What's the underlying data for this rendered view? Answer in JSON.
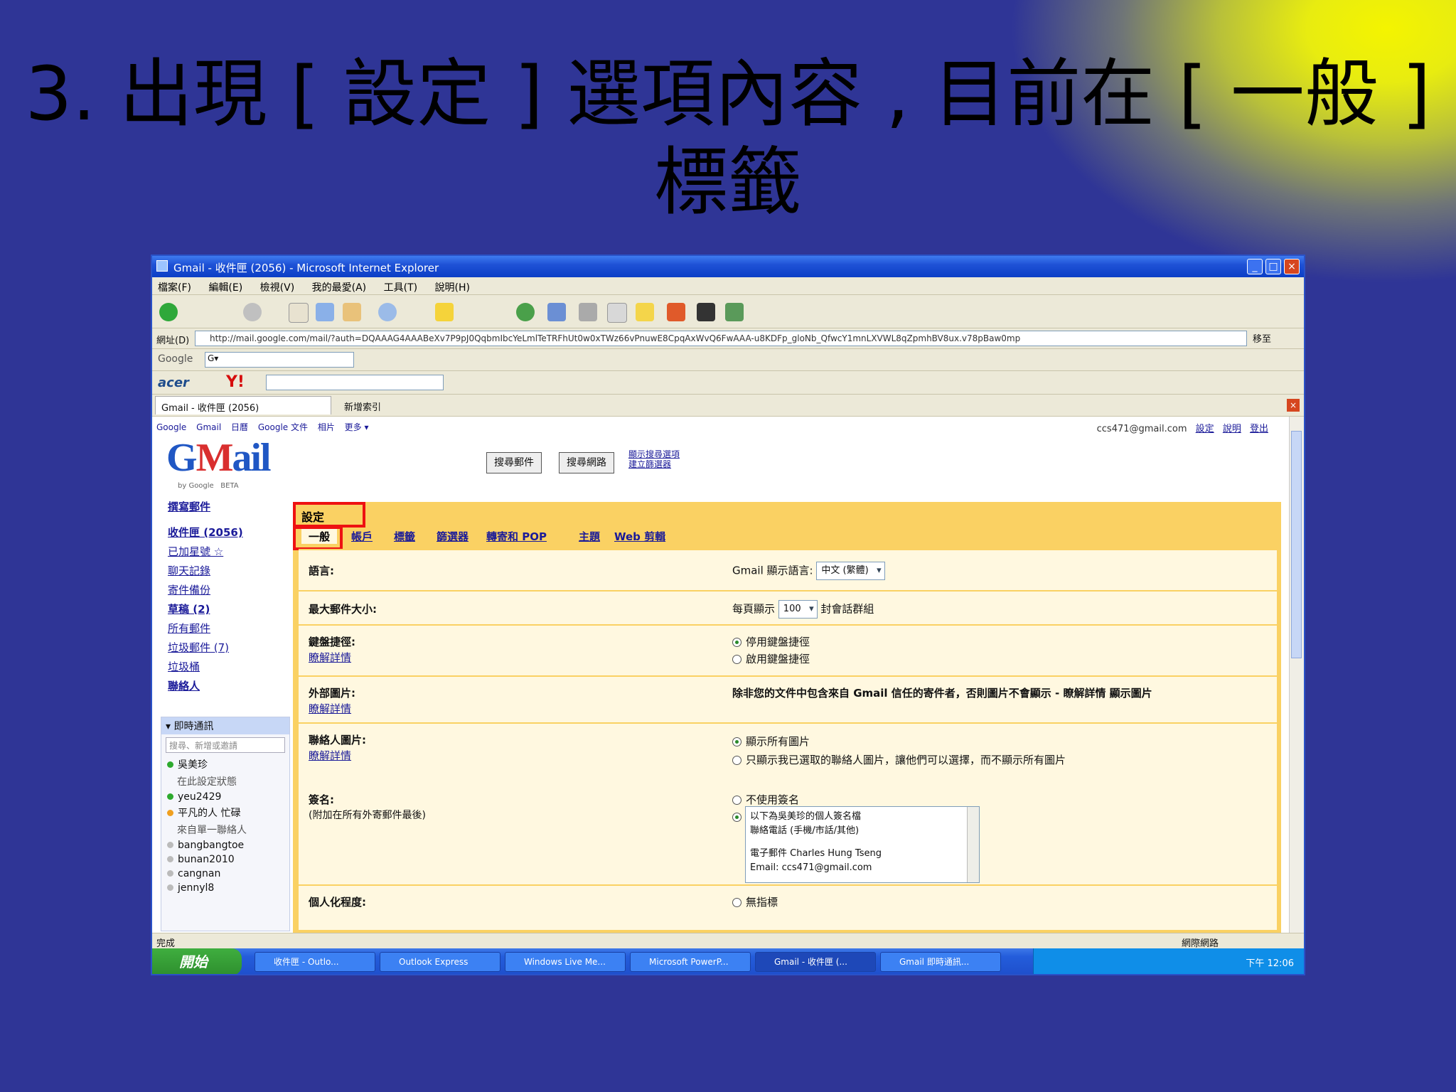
{
  "slide": {
    "title_line1": "3. 出現 [ 設定 ] 選項內容 , 目前在 [ 一般 ]",
    "title_line2": "標籤"
  },
  "window": {
    "title": "Gmail - 收件匣 (2056) - Microsoft Internet Explorer",
    "min": "_",
    "max": "□",
    "close": "×"
  },
  "menubar": [
    "檔案(F)",
    "編輯(E)",
    "檢視(V)",
    "我的最愛(A)",
    "工具(T)",
    "說明(H)"
  ],
  "addressbar": {
    "label": "網址(D)",
    "url": "http://mail.google.com/mail/?auth=DQAAAG4AAABeXv7P9pJ0QqbmIbcYeLmlTeTRFhUt0w0xTWz66vPnuwE8CpqAxWvQ6FwAAA-u8KDFp_gloNb_QfwcY1mnLXVWL8qZpmhBV8ux.v78pBaw0mp",
    "go": "移至"
  },
  "google_toolbar": {
    "label": "Google",
    "field": "G▾"
  },
  "yahoo_toolbar": {
    "acer": "acer",
    "yahoo": "Y!"
  },
  "tabs": {
    "active": "Gmail - 收件匣 (2056)",
    "new": "新增索引",
    "close": "×"
  },
  "gmail": {
    "topnav": [
      "Google",
      "Gmail",
      "日曆",
      "Google 文件",
      "相片",
      "更多 ▾"
    ],
    "account": "ccs471@gmail.com",
    "account_links": [
      "設定",
      "說明",
      "登出"
    ],
    "search_mail": "搜尋郵件",
    "search_web": "搜尋網路",
    "search_options": [
      "顯示搜尋選項",
      "建立篩選器"
    ],
    "logo_sub": "by Google",
    "beta": "BETA",
    "compose": "撰寫郵件",
    "nav": [
      {
        "label": "收件匣 (2056)",
        "bold": true
      },
      {
        "label": "已加星號 ☆",
        "bold": false
      },
      {
        "label": "聊天記錄",
        "bold": false
      },
      {
        "label": "寄件備份",
        "bold": false
      },
      {
        "label": "草稿 (2)",
        "bold": true
      },
      {
        "label": "所有郵件",
        "bold": false
      },
      {
        "label": "垃圾郵件 (7)",
        "bold": false
      },
      {
        "label": "垃圾桶",
        "bold": false
      },
      {
        "label": "聯絡人",
        "bold": true
      }
    ],
    "chat": {
      "header": "▾ 即時通訊",
      "search": "搜尋、新增或邀請",
      "me_name": "吳美珍",
      "me_status": "在此設定狀態",
      "contacts": [
        {
          "name": "yeu2429",
          "color": "#2eaa2e"
        },
        {
          "name": "平凡的人 忙碌",
          "color": "#f0a020"
        },
        {
          "name": "來自單一聯絡人",
          "color": "#ffffff"
        },
        {
          "name": "bangbangtoe",
          "color": "#bbbbbb"
        },
        {
          "name": "bunan2010",
          "color": "#bbbbbb"
        },
        {
          "name": "cangnan",
          "color": "#bbbbbb"
        },
        {
          "name": "jennyl8",
          "color": "#bbbbbb"
        }
      ]
    }
  },
  "settings": {
    "heading": "設定",
    "tabs": [
      "一般",
      "帳戶",
      "標籤",
      "篩選器",
      "轉寄和 POP",
      "主題",
      "Web 剪輯"
    ],
    "rows": [
      {
        "label": "語言:",
        "value_prefix": "Gmail 顯示語言:",
        "select": "中文 (繁體)"
      },
      {
        "label": "最大郵件大小:",
        "value_prefix": "每頁顯示",
        "select": "100",
        "value_suffix": "封會話群組"
      },
      {
        "label": "鍵盤捷徑:",
        "link": "瞭解詳情",
        "options": [
          {
            "text": "停用鍵盤捷徑",
            "on": true
          },
          {
            "text": "啟用鍵盤捷徑",
            "on": false
          }
        ]
      },
      {
        "label": "外部圖片:",
        "link": "瞭解詳情",
        "text": "除非您的文件中包含來自 Gmail 信任的寄件者，否則圖片不會顯示 - 瞭解詳情 顯示圖片"
      },
      {
        "label": "聯絡人圖片:",
        "link": "瞭解詳情",
        "options": [
          {
            "text": "顯示所有圖片",
            "on": true
          },
          {
            "text": "只顯示我已選取的聯絡人圖片，讓他們可以選擇，而不顯示所有圖片",
            "on": false
          }
        ]
      },
      {
        "label": "簽名:",
        "sublabel": "(附加在所有外寄郵件最後)",
        "options": [
          {
            "text": "不使用簽名",
            "on": false
          },
          {
            "text": "",
            "on": true
          }
        ],
        "sig_lines": [
          "以下為吳美珍的個人簽名檔",
          "聯絡電話 (手機/市話/其他)",
          "",
          "電子郵件 Charles Hung Tseng",
          "Email: ccs471@gmail.com"
        ]
      },
      {
        "label": "個人化程度:",
        "options": [
          {
            "text": "無指標",
            "on": false
          }
        ]
      }
    ]
  },
  "statusbar": {
    "text": "完成",
    "zone": "網際網路"
  },
  "taskbar": {
    "start": "開始",
    "tasks": [
      "收件匣 - Outlo...",
      "Outlook Express",
      "Windows Live Me...",
      "Microsoft PowerP...",
      "Gmail - 收件匣 (...",
      "Gmail 即時通訊..."
    ],
    "clock": "下午 12:06"
  }
}
